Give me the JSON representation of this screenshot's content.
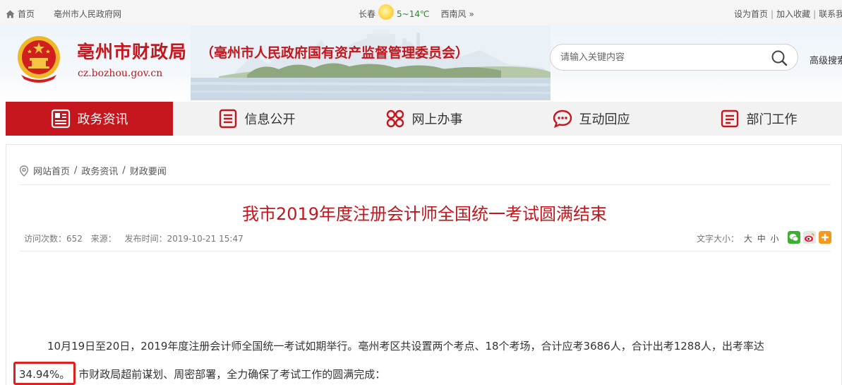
{
  "topbar": {
    "home": "首页",
    "gov_link": "亳州市人民政府网",
    "weather_city": "长春",
    "weather_temp": "5~14℃",
    "weather_wind": "西南风",
    "weather_more": "»",
    "set_home": "设为首页",
    "add_favorite": "加入收藏",
    "contact": "联系我",
    "separator": "|"
  },
  "header": {
    "title": "亳州市财政局",
    "subtitle": "（亳州市人民政府国有资产监督管理委员会）",
    "domain": "cz.bozhou.gov.cn",
    "search_placeholder": "请输入关键内容",
    "advanced_search": "高级搜索"
  },
  "nav": {
    "items": [
      {
        "label": "政务资讯",
        "icon": "news-icon",
        "active": true
      },
      {
        "label": "信息公开",
        "icon": "list-icon",
        "active": false
      },
      {
        "label": "网上办事",
        "icon": "grid-icon",
        "active": false
      },
      {
        "label": "互动回应",
        "icon": "chat-icon",
        "active": false
      },
      {
        "label": "部门工作",
        "icon": "document-icon",
        "active": false
      }
    ]
  },
  "breadcrumb": {
    "items": [
      "网站首页",
      "政务资讯",
      "财政要闻"
    ],
    "separator": "/"
  },
  "article": {
    "title": "我市2019年度注册会计师全国统一考试圆满结束",
    "visits_label": "访问次数：652",
    "source_label": "来源：",
    "publish_time": "发布时间：2019-10-21 15:47",
    "font_size_label": "文字大小：",
    "font_large": "大",
    "font_medium": "中",
    "font_small": "小",
    "para1": "10月19日至20日，2019年度注册会计师全国统一考试如期举行。亳州考区共设置两个考点、18个考场，合计应考3686人，合计出考1288人，出考率达",
    "para2_highlight": "34.94%。",
    "para2_rest": "市财政局超前谋划、周密部署，全力确保了考试工作的圆满完成："
  },
  "colors": {
    "brand_red": "#c4161c",
    "highlight_border": "#e0201e",
    "nav_bg": "#f2f2f2"
  }
}
